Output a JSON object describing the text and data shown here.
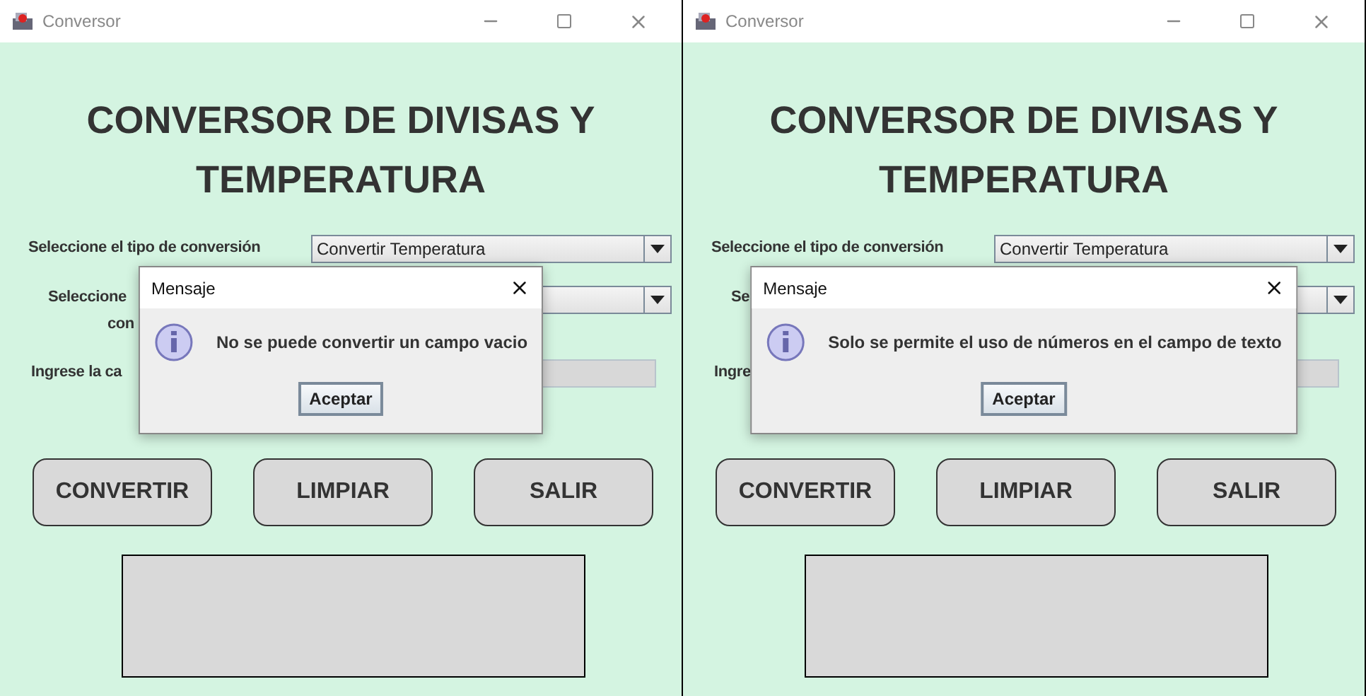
{
  "windows": [
    {
      "title": "Conversor",
      "heading": [
        "CONVERSOR DE DIVISAS Y",
        "TEMPERATURA"
      ],
      "rows": [
        {
          "kind": "select",
          "label": [
            "Seleccione el tipo de conversión"
          ],
          "value": "Convertir Temperatura"
        },
        {
          "kind": "select",
          "label": [
            "Seleccione",
            "con"
          ]
        },
        {
          "kind": "input",
          "label": [
            "Ingrese la ca"
          ]
        }
      ],
      "buttons": [
        "CONVERTIR",
        "LIMPIAR",
        "SALIR"
      ],
      "dialog": {
        "title": "Mensaje",
        "message": "No se puede convertir un campo vacio",
        "button": "Aceptar"
      }
    },
    {
      "title": "Conversor",
      "heading": [
        "CONVERSOR DE DIVISAS Y",
        "TEMPERATURA"
      ],
      "rows": [
        {
          "kind": "select",
          "label": [
            "Seleccione el tipo de conversión"
          ],
          "value": "Convertir Temperatura"
        },
        {
          "kind": "select",
          "label": [
            "Se"
          ]
        },
        {
          "kind": "input",
          "label": [
            "Ingre"
          ]
        }
      ],
      "buttons": [
        "CONVERTIR",
        "LIMPIAR",
        "SALIR"
      ],
      "dialog": {
        "title": "Mensaje",
        "message": "Solo se permite el uso de números en el campo de texto",
        "button": "Aceptar"
      }
    }
  ]
}
